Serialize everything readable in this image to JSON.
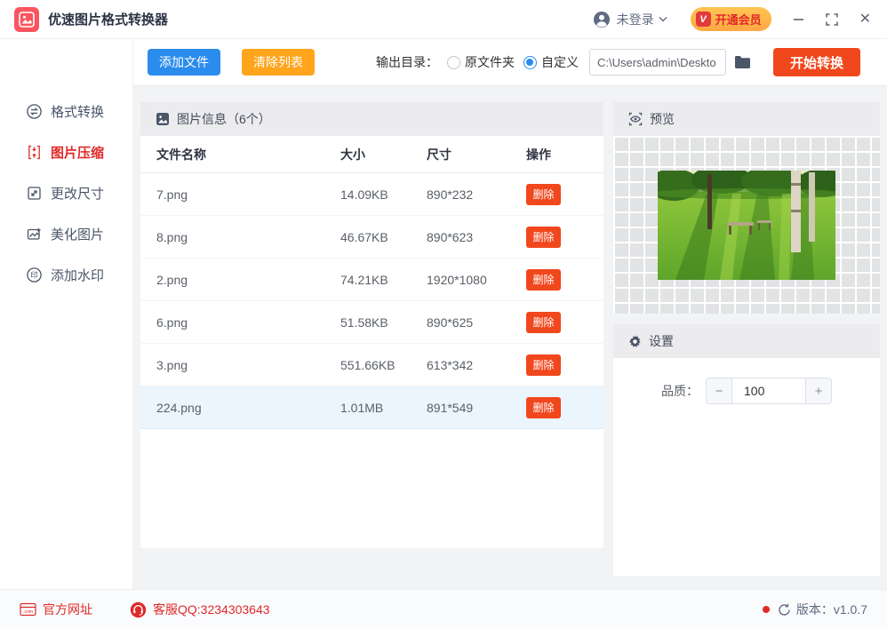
{
  "window": {
    "title": "优速图片格式转换器"
  },
  "header": {
    "login_label": "未登录",
    "vip_badge": "V",
    "vip_label": "开通会员"
  },
  "toolbar": {
    "add_files": "添加文件",
    "clear_list": "清除列表",
    "output_dir_label": "输出目录：",
    "radio_original": "原文件夹",
    "radio_custom": "自定义",
    "path_value": "C:\\Users\\admin\\Deskto",
    "start_convert": "开始转换"
  },
  "sidebar": {
    "items": [
      {
        "label": "格式转换",
        "active": false
      },
      {
        "label": "图片压缩",
        "active": true
      },
      {
        "label": "更改尺寸",
        "active": false
      },
      {
        "label": "美化图片",
        "active": false
      },
      {
        "label": "添加水印",
        "active": false
      }
    ],
    "watermark_icon_char": "印"
  },
  "table": {
    "panel_title": "图片信息（6个）",
    "columns": [
      "文件名称",
      "大小",
      "尺寸",
      "操作"
    ],
    "delete_label": "删除",
    "rows": [
      {
        "name": "7.png",
        "size": "14.09KB",
        "dims": "890*232",
        "selected": false
      },
      {
        "name": "8.png",
        "size": "46.67KB",
        "dims": "890*623",
        "selected": false
      },
      {
        "name": "2.png",
        "size": "74.21KB",
        "dims": "1920*1080",
        "selected": false
      },
      {
        "name": "6.png",
        "size": "51.58KB",
        "dims": "890*625",
        "selected": false
      },
      {
        "name": "3.png",
        "size": "551.66KB",
        "dims": "613*342",
        "selected": false
      },
      {
        "name": "224.png",
        "size": "1.01MB",
        "dims": "891*549",
        "selected": true
      }
    ]
  },
  "preview": {
    "title": "预览"
  },
  "settings": {
    "title": "设置",
    "quality_label": "品质：",
    "quality_value": "100",
    "minus_label": "−",
    "plus_label": "+"
  },
  "footer": {
    "website": "官方网址",
    "com_icon_text": ".com",
    "qq": "客服QQ:3234303643",
    "version": "版本：v1.0.7"
  },
  "colors": {
    "brand_red": "#fa5560",
    "accent_blue": "#2b8ced",
    "accent_orange": "#ffa41b",
    "accent_red": "#f1471d",
    "link_red": "#e02a2a",
    "vip_gradient_top": "#ffc553",
    "vip_gradient_bottom": "#ffa744",
    "selected_row_bg": "#eaf5fd",
    "panel_band_bg": "#ececee"
  }
}
